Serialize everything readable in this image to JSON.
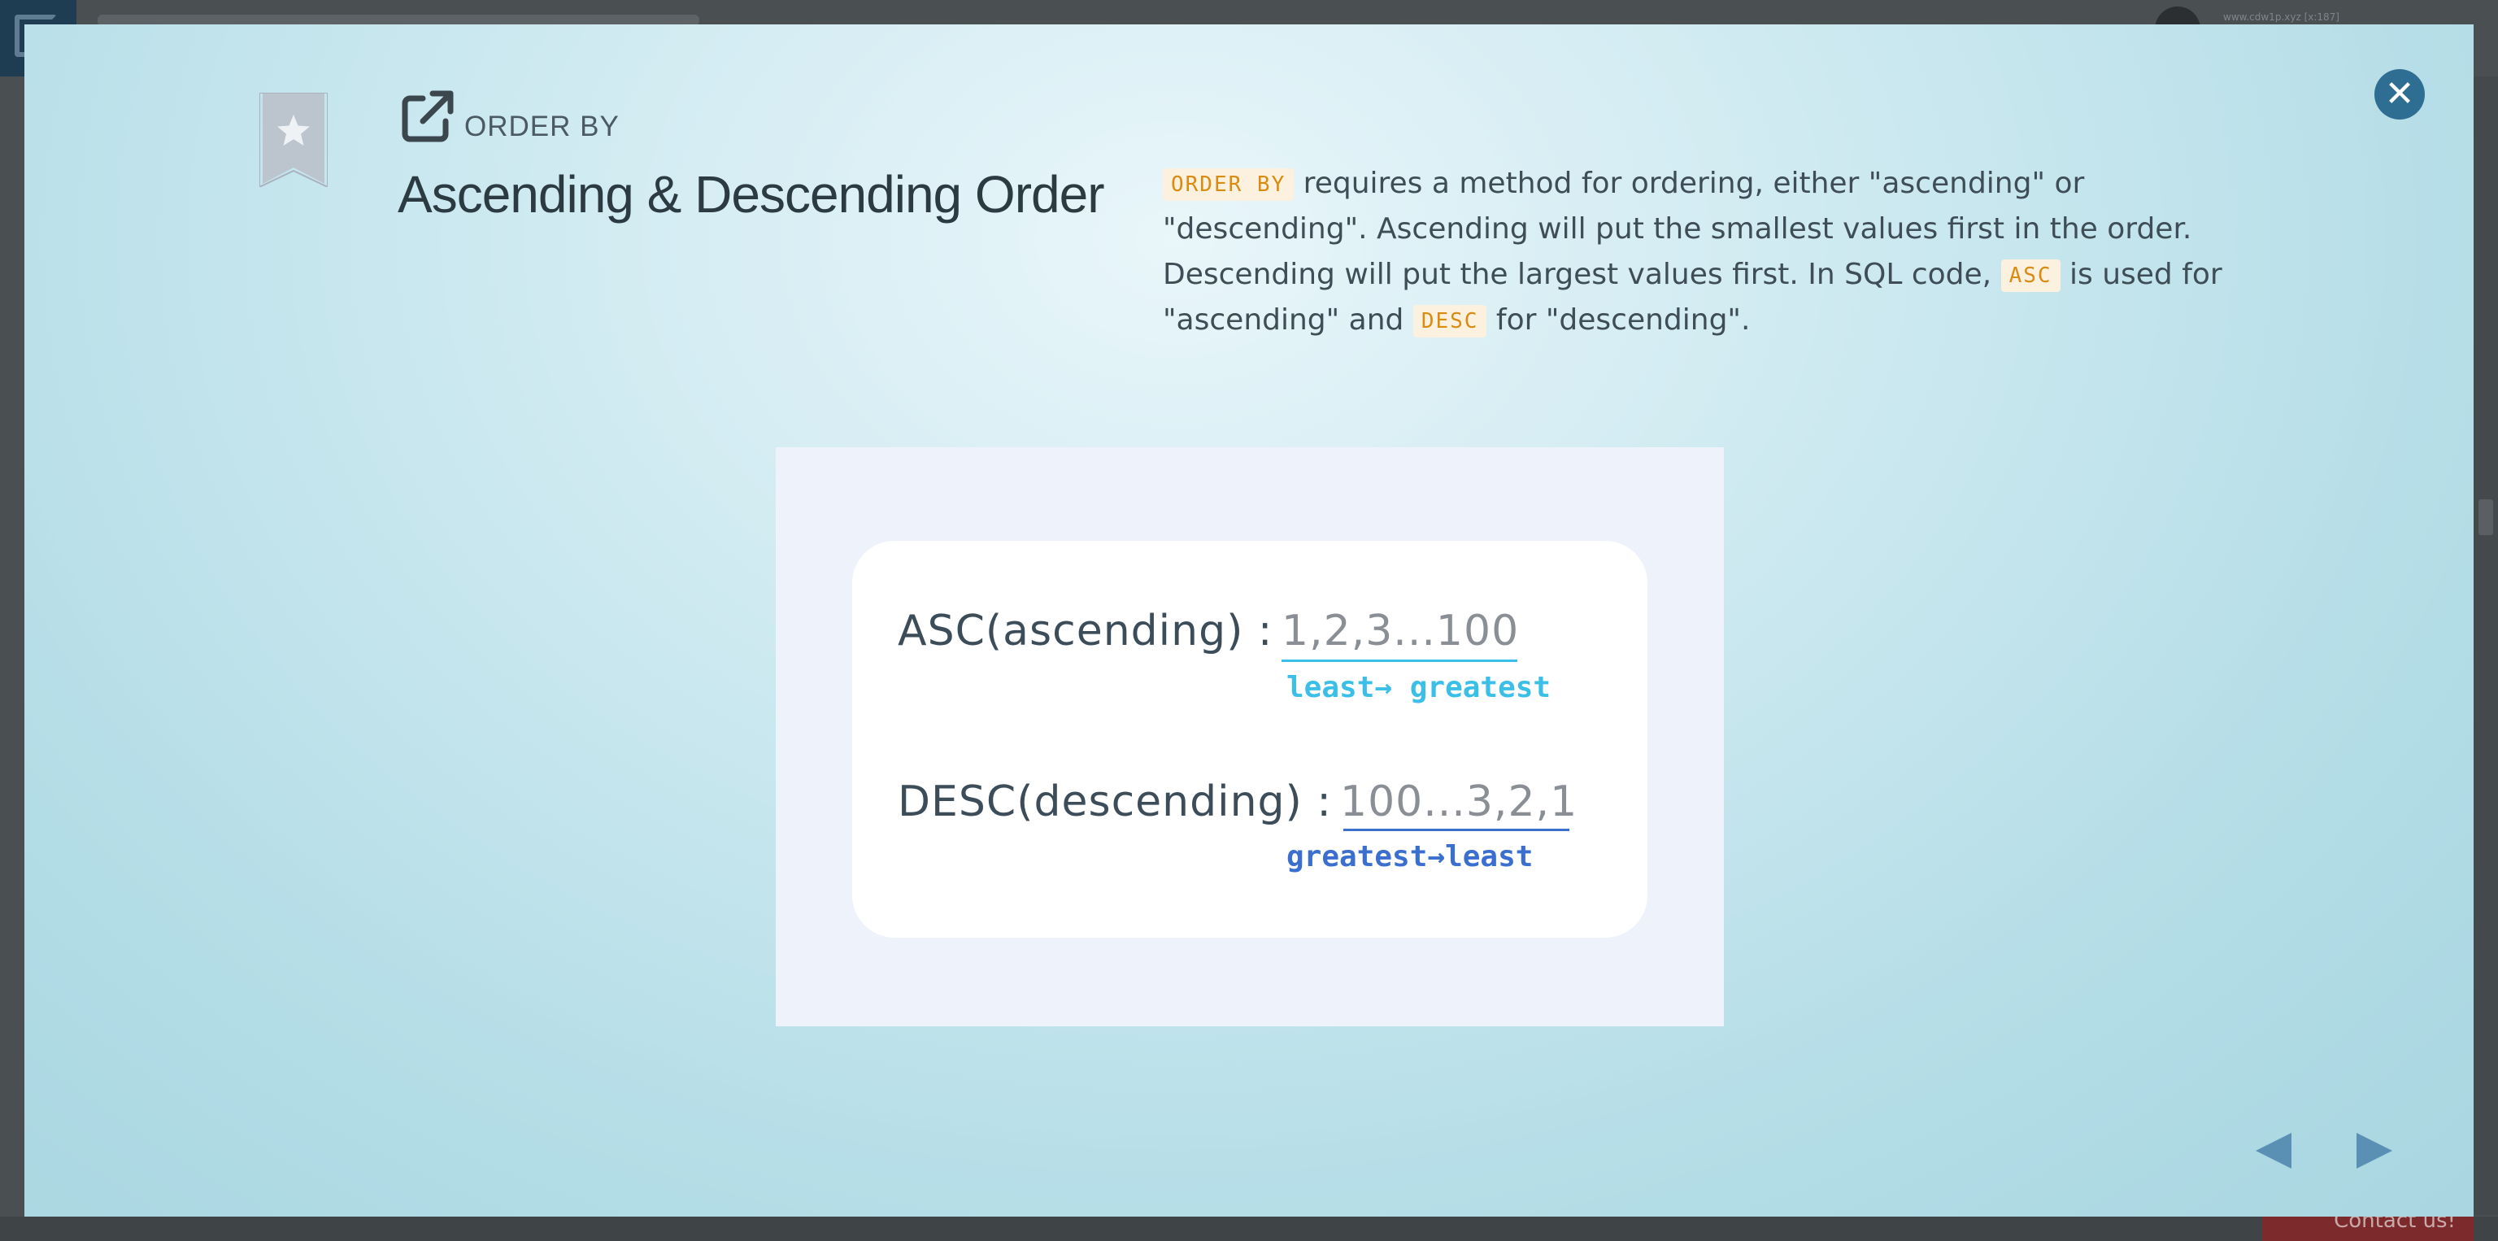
{
  "background": {
    "url_text": "www.cdw1p.xyz [x:187]",
    "contact_label": "Contact us!"
  },
  "modal": {
    "section": "ORDER BY",
    "title": "Ascending & Descending Order",
    "description": {
      "code_order_by": "ORDER BY",
      "part1": " requires a method for ordering, either \"ascending\" or \"descending\". Ascending will put the smallest values first in the order. Descending will put the largest values first. In SQL code, ",
      "code_asc": "ASC",
      "part2": " is used for \"ascending\" and ",
      "code_desc": "DESC",
      "part3": " for \"descending\"."
    },
    "illustration": {
      "asc_label": "ASC(ascending) :",
      "asc_sequence": "1,2,3...100",
      "asc_direction": "least→ greatest",
      "desc_label": "DESC(descending) :",
      "desc_sequence": "100...3,2,1",
      "desc_direction": "greatest→least"
    },
    "colors": {
      "asc_accent": "#3bbfe8",
      "desc_accent": "#3a6fd0",
      "code_text": "#d98b12",
      "code_bg": "#fbf1de",
      "close_button": "#2f6e93",
      "nav_arrows": "#5a90b4"
    },
    "icons": {
      "close": "close-icon",
      "bookmark": "bookmark-star-icon",
      "external_link": "external-link-icon",
      "prev": "triangle-left-icon",
      "next": "triangle-right-icon"
    }
  }
}
